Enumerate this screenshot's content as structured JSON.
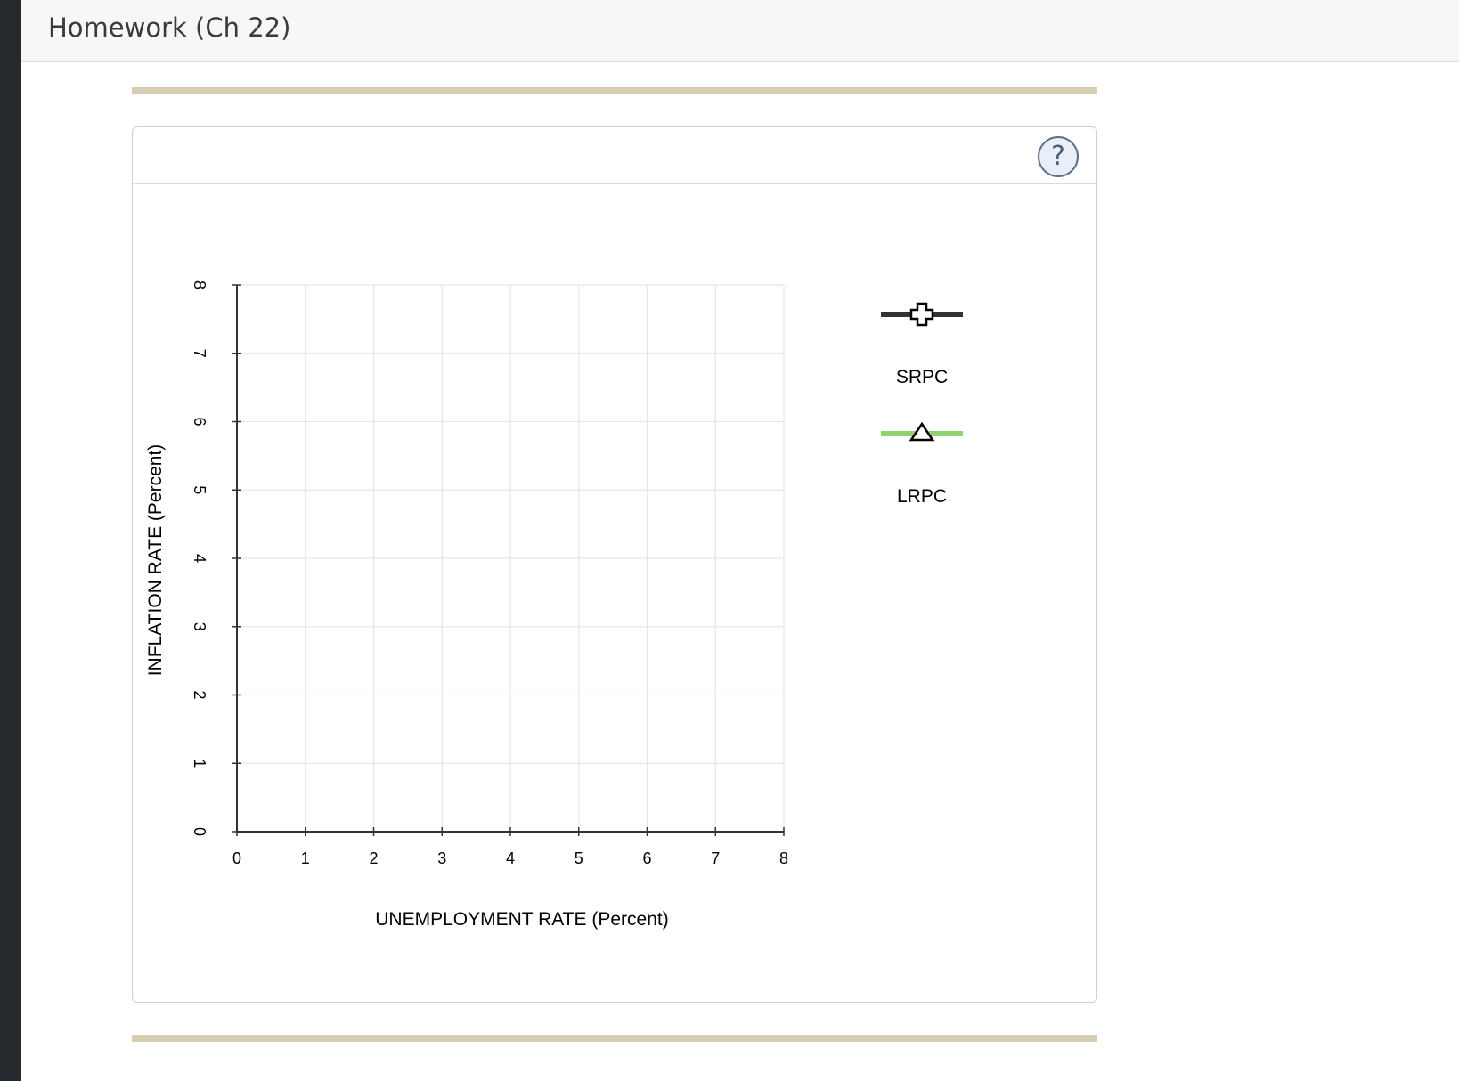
{
  "page": {
    "title": "Homework (Ch 22)"
  },
  "help_button": {
    "label": "?"
  },
  "chart_data": {
    "type": "line",
    "title": "",
    "xlabel": "UNEMPLOYMENT RATE (Percent)",
    "ylabel": "INFLATION RATE (Percent)",
    "xlim": [
      0,
      8
    ],
    "ylim": [
      0,
      8
    ],
    "x_ticks": [
      0,
      1,
      2,
      3,
      4,
      5,
      6,
      7,
      8
    ],
    "y_ticks": [
      0,
      1,
      2,
      3,
      4,
      5,
      6,
      7,
      8
    ],
    "grid": true,
    "legend_position": "right",
    "series": []
  },
  "legend": [
    {
      "label": "SRPC",
      "color": "#333333",
      "marker": "plus-icon"
    },
    {
      "label": "LRPC",
      "color": "#8fd26f",
      "marker": "triangle-icon"
    }
  ],
  "colors": {
    "rule": "#d6ceb2",
    "grid": "#e6e6e6",
    "axis": "#333333"
  }
}
